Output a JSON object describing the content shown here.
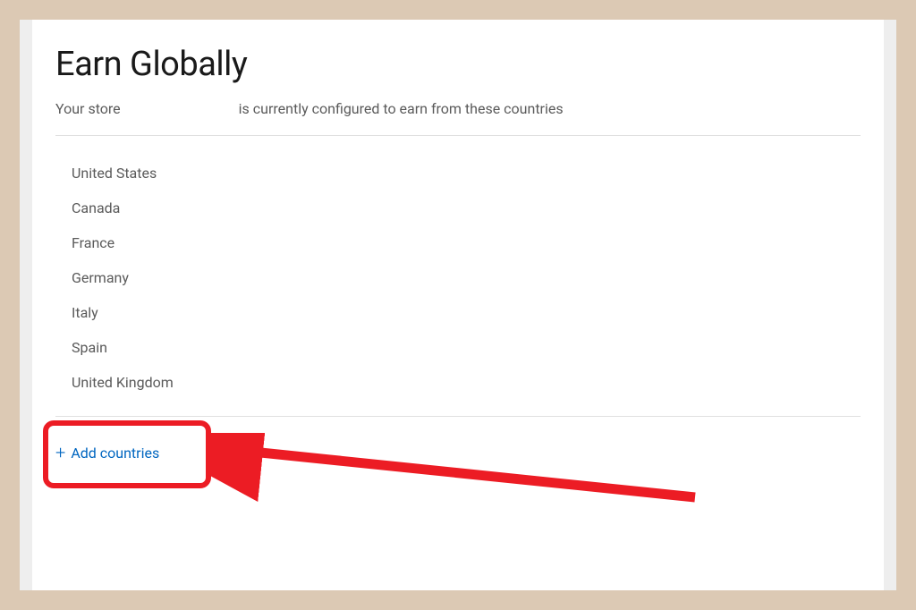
{
  "header": {
    "title": "Earn Globally",
    "subtitle_prefix": "Your store",
    "subtitle_suffix": "is currently configured to earn from these countries"
  },
  "countries": [
    "United States",
    "Canada",
    "France",
    "Germany",
    "Italy",
    "Spain",
    "United Kingdom"
  ],
  "actions": {
    "add_countries_label": "Add countries"
  },
  "annotation": {
    "highlight_color": "#ec1c24"
  }
}
